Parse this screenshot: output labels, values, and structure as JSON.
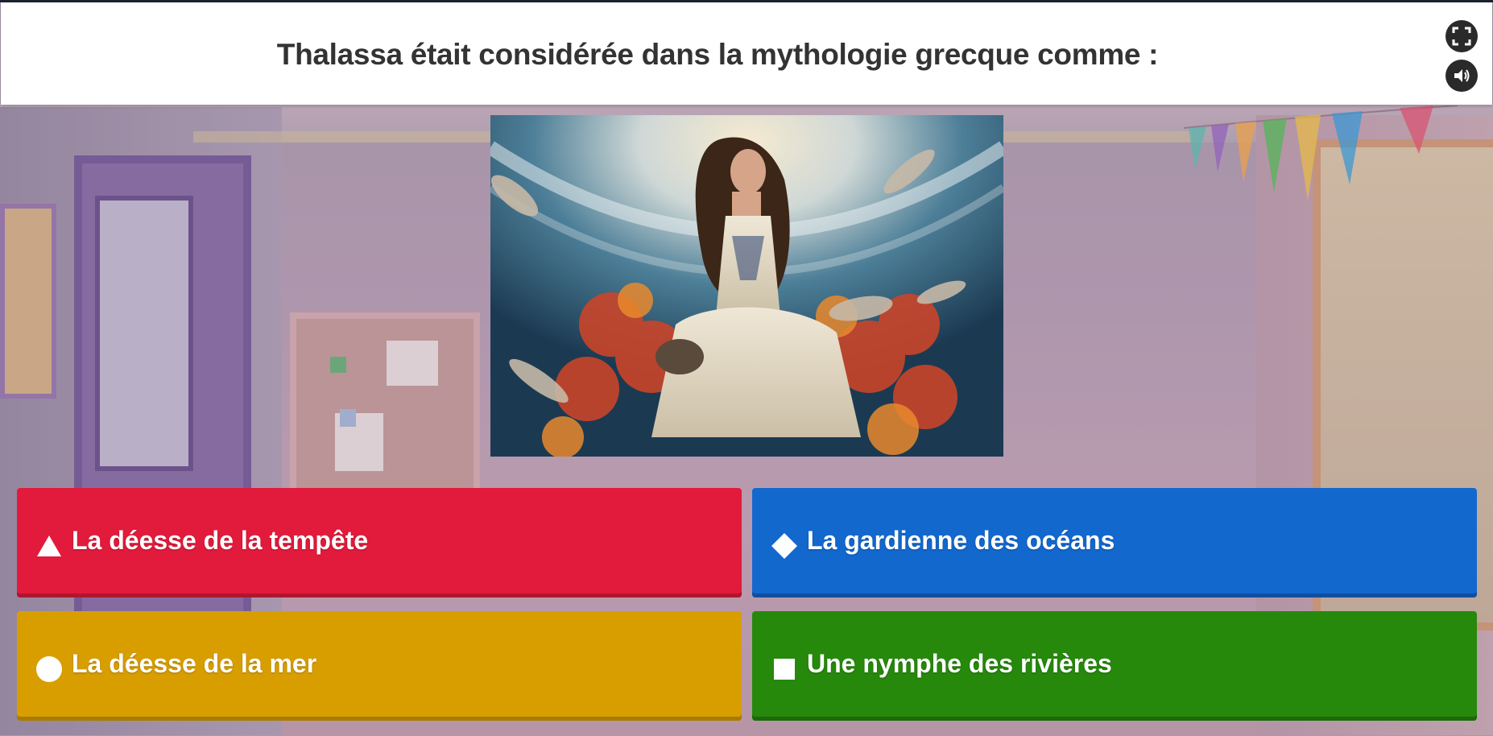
{
  "question": {
    "text": "Thalassa était considérée dans la mythologie grecque comme :"
  },
  "header_buttons": {
    "fullscreen_icon": "fullscreen-icon",
    "sound_icon": "speaker-icon"
  },
  "image": {
    "subject": "woman-sea-goddess-illustration"
  },
  "answers": [
    {
      "label": "La déesse de la tempête",
      "shape": "triangle",
      "color": "#e21b3c"
    },
    {
      "label": "La gardienne des océans",
      "shape": "diamond",
      "color": "#1368ce"
    },
    {
      "label": "La déesse de la mer",
      "shape": "circle",
      "color": "#d89e00"
    },
    {
      "label": "Une nymphe des rivières",
      "shape": "square",
      "color": "#26890c"
    }
  ]
}
